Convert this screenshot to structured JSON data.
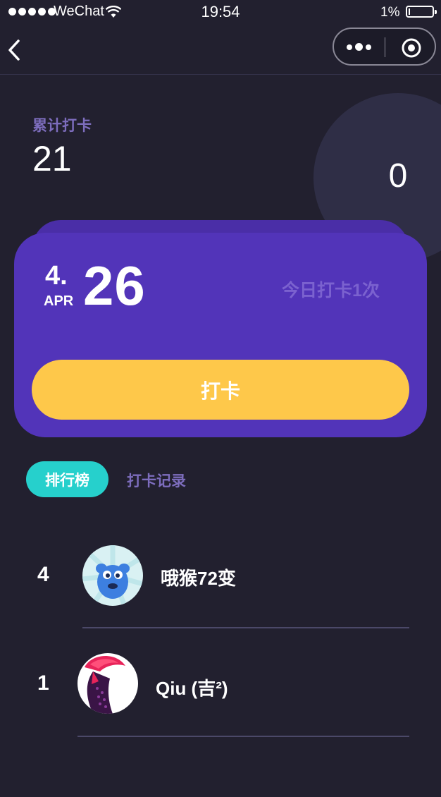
{
  "status_bar": {
    "carrier": "WeChat",
    "time": "19:54",
    "battery": "1%"
  },
  "stats": {
    "total_label": "累计打卡",
    "total_value": "21",
    "right_value": "0"
  },
  "card": {
    "month_num": "4.",
    "month_name": "APR",
    "day": "26",
    "today_count": "今日打卡1次",
    "checkin_label": "打卡"
  },
  "tabs": {
    "ranking": "排行榜",
    "records": "打卡记录"
  },
  "ranking_list": [
    {
      "rank": "4",
      "name": "哦猴72变",
      "avatar_icon": "blue-monster-avatar-icon"
    },
    {
      "rank": "1",
      "name": "Qiu (吉²)",
      "avatar_icon": "rooster-avatar-icon"
    }
  ],
  "colors": {
    "background": "#22202f",
    "card": "#5234b9",
    "button": "#fec84a",
    "tab_active": "#26d0cc",
    "label": "#7d6dbd"
  }
}
